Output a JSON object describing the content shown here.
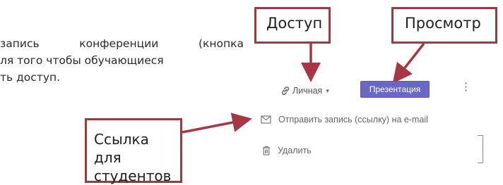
{
  "paragraph": {
    "line1": "запись конференции (кнопка",
    "line2": "ля того чтобы обучающиеся",
    "line3": "ть доступ."
  },
  "callouts": {
    "access": "Доступ",
    "preview": "Просмотр",
    "student_link_line1": "Ссылка для",
    "student_link_line2": "студентов"
  },
  "toolbar": {
    "visibility_label": "Личная",
    "visibility_icon": "link-icon",
    "presentation_label": "Презентация",
    "more_icon": "more-vert-icon"
  },
  "menu": {
    "send_email": "Отправить запись (ссылку) на e-mail",
    "send_email_icon": "envelope-icon",
    "delete": "Удалить",
    "delete_icon": "trash-icon"
  },
  "colors": {
    "callout_border": "#9a3a42",
    "arrow": "#a83745",
    "presentation_button": "#6a67c5"
  }
}
